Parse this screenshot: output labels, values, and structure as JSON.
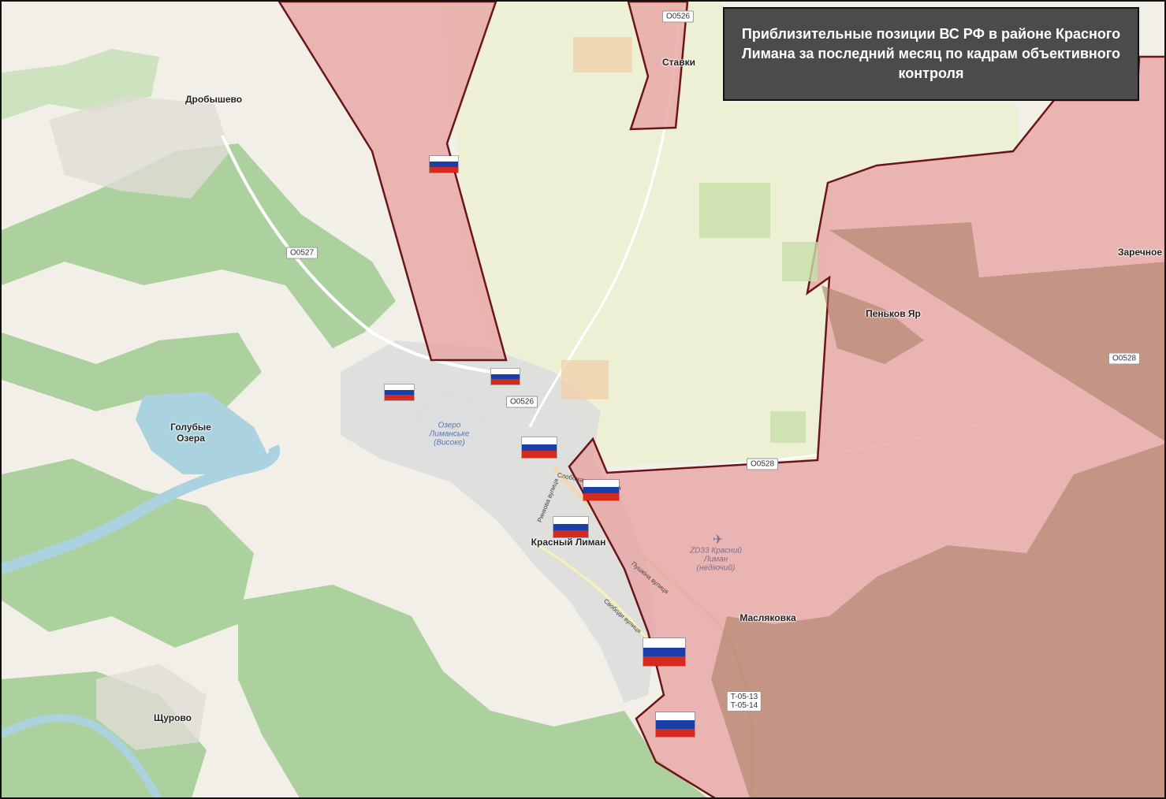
{
  "title": "Приблизительные позиции ВС РФ в районе Красного Лимана за последний месяц по кадрам объективного контроля",
  "colors": {
    "occupied_fill": "#e8a3a3",
    "occupied_border": "#6b1616",
    "forest": "#add19e",
    "fields": "#eef0d5",
    "water": "#aad3df",
    "urban": "#dddddd"
  },
  "places": {
    "drobyshevo": "Дробышево",
    "stavki": "Ставки",
    "golubye_ozera": "Голубые\nОзера",
    "krasny_liman": "Красный Лиман",
    "shchurovo": "Щурово",
    "penkov_yar": "Пеньков Яр",
    "zarechnoe": "Заречное",
    "maslyakovka": "Масляковка"
  },
  "roads": {
    "o0526_top": "O0526",
    "o0527": "O0527",
    "o0526_mid": "O0526",
    "o0528_right": "O0528",
    "o0528_mid": "O0528",
    "t0513": "T-05-13\nT-05-14"
  },
  "water_labels": {
    "lake": "Озеро\nЛиманське\n(Високе)"
  },
  "airport_label": "ZD33 Красний\nЛиман\n(недіючий)",
  "streets": {
    "rynkova": "Ринкова вулиця",
    "slobozhanska": "Слобожанська вулиця",
    "pushkina": "Пушкіна вулиця",
    "svobody": "Свободи вулиця"
  },
  "flags_icon": "russian-flag-icon"
}
